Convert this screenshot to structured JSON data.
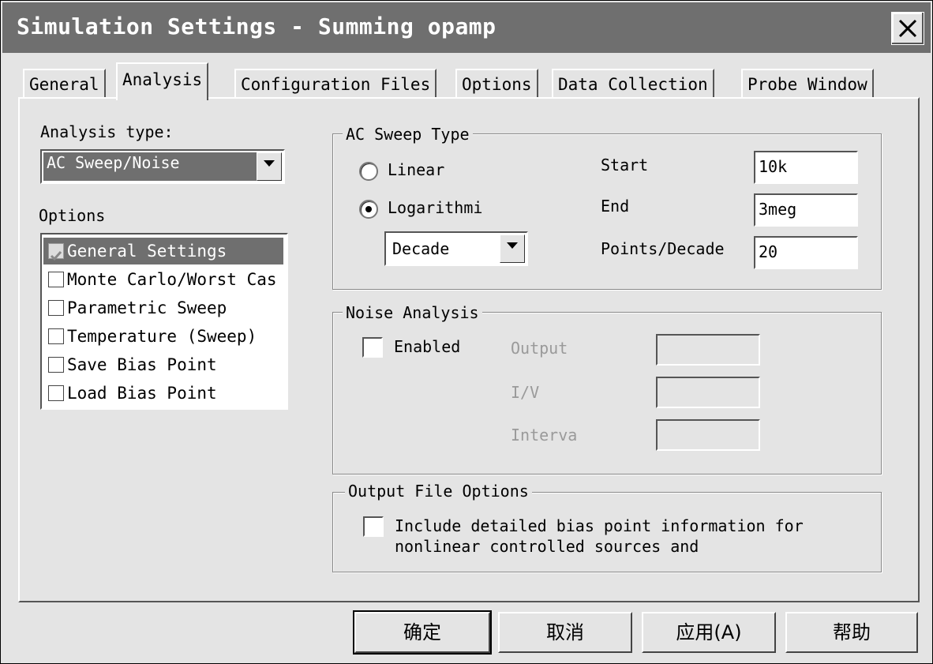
{
  "window": {
    "title": "Simulation Settings - Summing opamp"
  },
  "tabs": [
    {
      "label": "General"
    },
    {
      "label": "Analysis"
    },
    {
      "label": "Configuration Files"
    },
    {
      "label": "Options"
    },
    {
      "label": "Data Collection"
    },
    {
      "label": "Probe Window"
    }
  ],
  "active_tab": "Analysis",
  "analysis_type": {
    "label": "Analysis type:",
    "value": "AC Sweep/Noise"
  },
  "options": {
    "label": "Options",
    "items": [
      {
        "label": "General Settings",
        "checked": true,
        "selected": true
      },
      {
        "label": "Monte Carlo/Worst Cas",
        "checked": false
      },
      {
        "label": "Parametric Sweep",
        "checked": false
      },
      {
        "label": "Temperature (Sweep)",
        "checked": false
      },
      {
        "label": "Save Bias Point",
        "checked": false
      },
      {
        "label": "Load Bias Point",
        "checked": false
      }
    ]
  },
  "ac_sweep": {
    "title": "AC Sweep Type",
    "linear_label": "Linear",
    "log_label": "Logarithmi",
    "selected": "Logarithmi",
    "log_mode": "Decade",
    "start_label": "Start",
    "start_value": "10k",
    "end_label": "End",
    "end_value": "3meg",
    "points_label": "Points/Decade",
    "points_value": "20"
  },
  "noise": {
    "title": "Noise Analysis",
    "enabled_label": "Enabled",
    "output_label": "Output",
    "iv_label": "I/V",
    "interval_label": "Interva"
  },
  "output_file": {
    "title": "Output File Options",
    "line1": "Include detailed bias point information for",
    "line2": "nonlinear controlled sources and"
  },
  "buttons": {
    "ok": "确定",
    "cancel": "取消",
    "apply": "应用(A)",
    "help": "帮助"
  }
}
